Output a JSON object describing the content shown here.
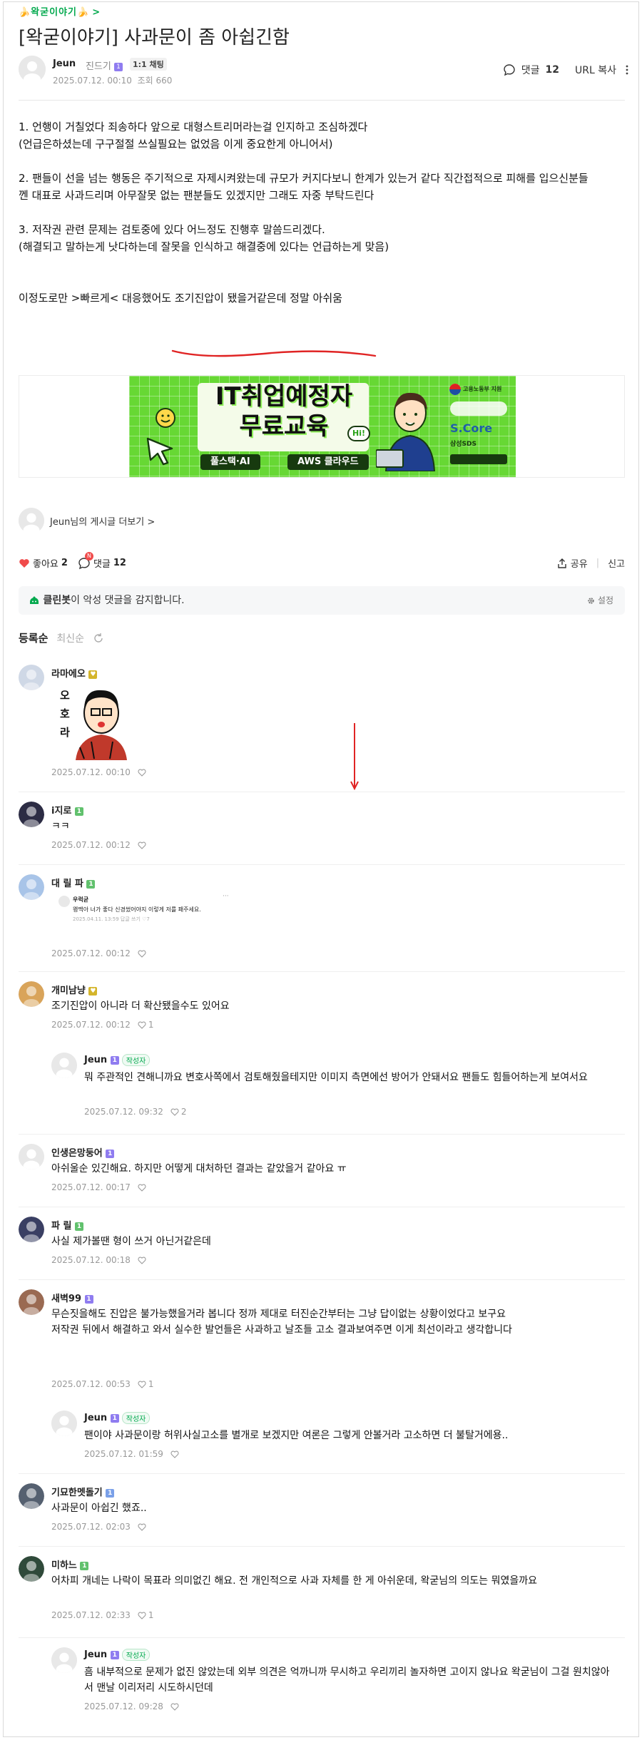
{
  "board": {
    "name": "🍌왁굳이야기🍌",
    "chevron": ">"
  },
  "post": {
    "title": "[왁굳이야기] 사과문이 좀 아쉽긴함",
    "author": "Jeun",
    "author_rank": "진드기",
    "chat_label": "1:1 채팅",
    "date": "2025.07.12. 00:10",
    "views_label": "조회 660",
    "comment_label": "댓글",
    "comment_count": "12",
    "url_copy": "URL 복사",
    "body": [
      "1. 언행이 거칠었다 죄송하다 앞으로 대형스트리머라는걸 인지하고 조심하겠다",
      "(언급은하셨는데 구구절절 쓰실필요는 없었음 이게 중요한게 아니어서)",
      "",
      "2. 팬들이 선을 넘는 행동은 주기적으로 자제시켜왔는데 규모가 커지다보니 한계가 있는거 같다 직간접적으로 피해를 입으신분들",
      "껜 대표로 사과드리며 아무잘못 없는 팬분들도 있겠지만 그래도 자중 부탁드린다",
      "",
      "3. 저작권 관련 문제는 검토중에 있다 어느정도 진행후 말씀드리겠다.",
      "(해결되고 말하는게 낫다하는데 잘못을 인식하고 해결중에 있다는 언급하는게 맞음)",
      "",
      "",
      "이정도로만 >빠르게< 대응했어도 조기진압이 됐을거같은데 정말 아쉬움"
    ],
    "banner": {
      "title_line1": "IT취업예정자",
      "title_line2": "무료교육",
      "tag1": "풀스택·AI",
      "tag2": "AWS 클라우드",
      "hi": "Hi!",
      "brand": "S.Core",
      "brand_sub": "삼성SDS",
      "org": "고용노동부 지원"
    },
    "more_posts": "Jeun님의 게시글 더보기 >",
    "like_label": "좋아요",
    "like_count": "2",
    "comment_count_bottom": "12",
    "comment_badge": "N",
    "share": "공유",
    "report": "신고"
  },
  "cleanbot": {
    "name": "클린봇",
    "text": "이 악성 댓글을 감지합니다.",
    "setting": "설정"
  },
  "sort": {
    "registered": "등록순",
    "latest": "최신순"
  },
  "ui": {
    "like_count_comment_1": "1",
    "like_count_comment_2": "2"
  },
  "comments": [
    {
      "name": "라마에오",
      "text": "",
      "sticker_text": "오호라",
      "date": "2025.07.12. 00:10",
      "likes": ""
    },
    {
      "name": "i지로",
      "text": "ㅋㅋ",
      "date": "2025.07.12. 00:12",
      "likes": ""
    },
    {
      "name": "대 릴 파",
      "text": "",
      "quote_author": "우럭굳",
      "quote_text": "왱맥아 너가 좋다 신경썼어야지 이렇게 저를 패주세요.",
      "quote_meta": "2025.04.11. 13:59  답글 쓰기  ♡7",
      "date": "2025.07.12. 00:12",
      "likes": ""
    },
    {
      "name": "개미남냥",
      "text": "조기진압이 아니라 더 확산됐을수도 있어요",
      "date": "2025.07.12. 00:12",
      "likes": "1"
    },
    {
      "name": "Jeun",
      "writer": "작성자",
      "text": "뭐 주관적인 견해니까요 변호사쪽에서 검토해줬을테지만 이미지 측면에선 방어가 안돼서요 팬들도 힘들어하는게 보여서요",
      "date": "2025.07.12. 09:32",
      "likes": "2"
    },
    {
      "name": "인생은망둥어",
      "text": "아쉬울순 있긴해요. 하지만 어떻게 대처하던 결과는 같았을거 같아요 ㅠ",
      "date": "2025.07.12. 00:17",
      "likes": ""
    },
    {
      "name": "파 릴",
      "text": "사실 제가볼땐 형이 쓰거 아닌거같은데",
      "date": "2025.07.12. 00:18",
      "likes": ""
    },
    {
      "name": "새벽99",
      "text": "무슨짓을해도 진압은 불가능했을거라 봅니다 정까 제대로 터진순간부터는 그냥 답이없는 상황이었다고 보구요\n저작권 뒤에서 해결하고 와서 실수한 발언들은 사과하고 날조들 고소 결과보여주면 이게 최선이라고 생각합니다",
      "date": "2025.07.12. 00:53",
      "likes": "1"
    },
    {
      "name": "Jeun",
      "writer": "작성자",
      "text": "팬이야 사과문이랑 허위사실고소를 별개로 보겠지만 여론은 그렇게 안볼거라 고소하면 더 불탈거에용..",
      "date": "2025.07.12. 01:59",
      "likes": ""
    },
    {
      "name": "기묘한멧돌기",
      "text": "사과문이 아쉽긴 했죠..",
      "date": "2025.07.12. 02:03",
      "likes": ""
    },
    {
      "name": "미하느",
      "text": "어차피 개네는 나락이 목표라 의미없긴 해요. 전 개인적으로 사과 자체를 한 게 아쉬운데, 왁굳님의 의도는 뭐였을까요",
      "date": "2025.07.12. 02:33",
      "likes": "1"
    },
    {
      "name": "Jeun",
      "writer": "작성자",
      "text": "흠 내부적으로 문제가 없진 않았는데 외부 의견은 억까니까 무시하고 우리끼리 놀자하면 고이지 않나요 왁굳님이 그걸 원치않아서 맨날 이리저리 시도하시던데",
      "date": "2025.07.12. 09:28",
      "likes": ""
    }
  ]
}
